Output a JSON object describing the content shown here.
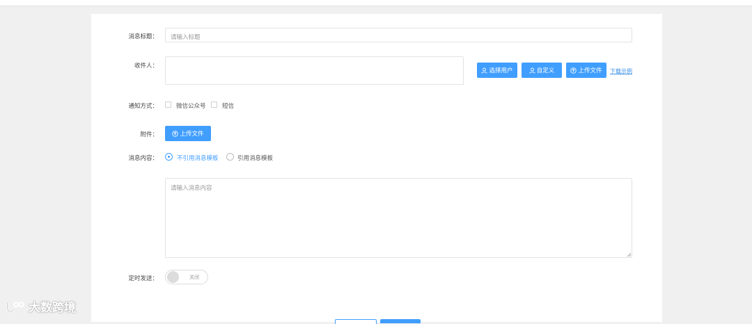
{
  "form": {
    "title": {
      "label": "消息标题：",
      "placeholder": "请输入标题"
    },
    "recipient": {
      "label": "收件人：",
      "select_user_button": "选择用户",
      "custom_button": "自定义",
      "upload_file_button": "上传文件",
      "download_example_link": "下载示例"
    },
    "notify": {
      "label": "通知方式：",
      "options": [
        "微信公众号",
        "短信"
      ]
    },
    "attachment": {
      "label": "附件：",
      "upload_button": "上传文件"
    },
    "content": {
      "label": "消息内容：",
      "radio_no_template": "不引用消息模板",
      "radio_template": "引用消息模板",
      "placeholder": "请输入消息内容"
    },
    "scheduled": {
      "label": "定时发送：",
      "switch_text": "关闭"
    }
  },
  "watermark": {
    "text": "大数跨境"
  },
  "colors": {
    "primary": "#409eff",
    "link": "#3a8ee6",
    "page_bg": "#f0f0f0"
  },
  "icons": {
    "user": "user-icon",
    "upload": "upload-circle-icon"
  }
}
